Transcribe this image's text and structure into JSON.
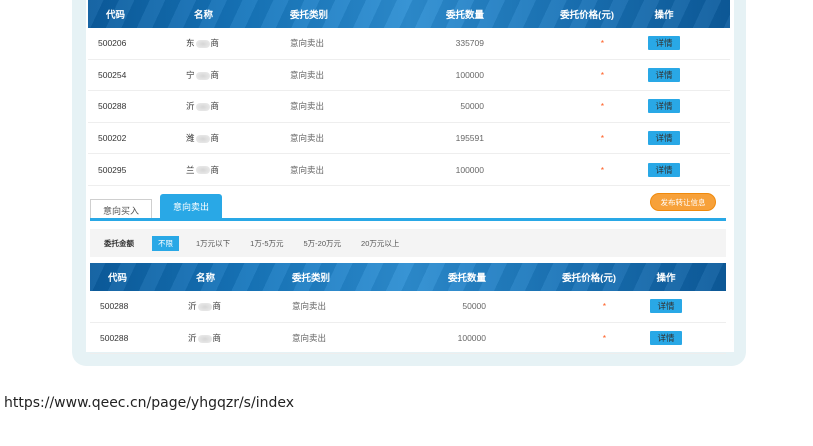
{
  "columns": {
    "code": "代码",
    "name": "名称",
    "type": "委托类别",
    "qty": "委托数量",
    "price": "委托价格(元)",
    "op": "操作"
  },
  "table_top": [
    {
      "code": "500206",
      "name_prefix": "东",
      "name_suffix": "商",
      "type": "意向卖出",
      "qty": "335709",
      "price": "*",
      "action": "详情"
    },
    {
      "code": "500254",
      "name_prefix": "宁",
      "name_suffix": "商",
      "type": "意向卖出",
      "qty": "100000",
      "price": "*",
      "action": "详情"
    },
    {
      "code": "500288",
      "name_prefix": "沂",
      "name_suffix": "商",
      "type": "意向卖出",
      "qty": "50000",
      "price": "*",
      "action": "详情"
    },
    {
      "code": "500202",
      "name_prefix": "潍",
      "name_suffix": "商",
      "type": "意向卖出",
      "qty": "195591",
      "price": "*",
      "action": "详情"
    },
    {
      "code": "500295",
      "name_prefix": "兰",
      "name_suffix": "商",
      "type": "意向卖出",
      "qty": "100000",
      "price": "*",
      "action": "详情"
    }
  ],
  "tabs": {
    "buy": "意向买入",
    "sell": "意向卖出"
  },
  "post_button": "发布转让信息",
  "filter": {
    "label": "委托金额",
    "options": [
      "不限",
      "1万元以下",
      "1万-5万元",
      "5万-20万元",
      "20万元以上"
    ]
  },
  "table_bottom": [
    {
      "code": "500288",
      "name_prefix": "沂",
      "name_suffix": "商",
      "type": "意向卖出",
      "qty": "50000",
      "price": "*",
      "action": "详情"
    },
    {
      "code": "500288",
      "name_prefix": "沂",
      "name_suffix": "商",
      "type": "意向卖出",
      "qty": "100000",
      "price": "*",
      "action": "详情"
    }
  ],
  "url": "https://www.qeec.cn/page/yhgqzr/s/index",
  "colors": {
    "accent": "#29a8e6",
    "header_blue": "#1777bd",
    "price_red": "#ff5a1f",
    "post_orange": "#f7a13a",
    "frame_bg": "#e6f2f5"
  }
}
